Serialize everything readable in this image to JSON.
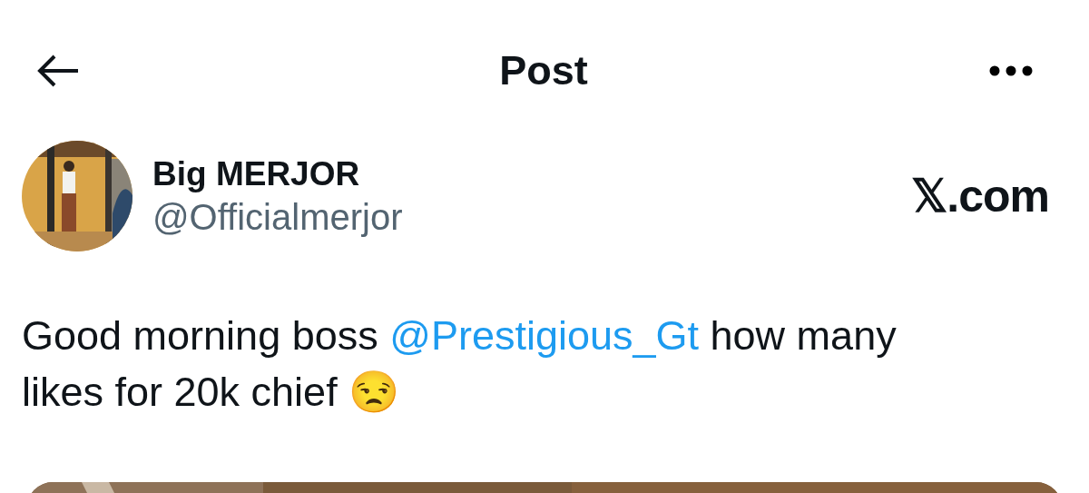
{
  "header": {
    "title": "Post"
  },
  "author": {
    "name": "Big MERJOR",
    "handle": "@Officialmerjor"
  },
  "site_mark": "𝕏.com",
  "post": {
    "segments": [
      {
        "kind": "text",
        "text": "Good morning boss "
      },
      {
        "kind": "mention",
        "text": "@Prestigious_Gt"
      },
      {
        "kind": "text",
        "text": " how many likes for 20k chief 😒"
      }
    ]
  }
}
